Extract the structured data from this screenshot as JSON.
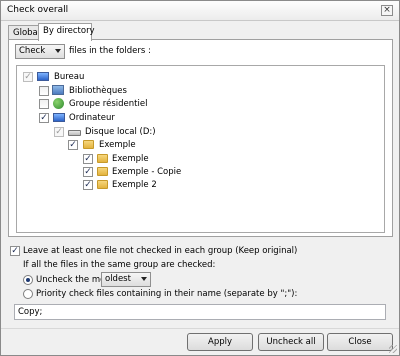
{
  "window": {
    "title": "Check overall",
    "close_glyph": "×"
  },
  "tabs": [
    {
      "label": "Global",
      "active": false
    },
    {
      "label": "By directory",
      "active": true
    }
  ],
  "by_directory": {
    "action_select": {
      "value": "Check"
    },
    "action_suffix": "files in the folders :",
    "tree": [
      {
        "label": "Bureau",
        "checked": "gray",
        "icon": "desktop-icon"
      },
      {
        "label": "Bibliothèques",
        "checked": "unchecked",
        "icon": "library-icon"
      },
      {
        "label": "Groupe résidentiel",
        "checked": "unchecked",
        "icon": "homegroup-icon"
      },
      {
        "label": "Ordinateur",
        "checked": "checked",
        "icon": "computer-icon"
      },
      {
        "label": "Disque local (D:)",
        "checked": "gray",
        "icon": "drive-icon"
      },
      {
        "label": "Exemple",
        "checked": "checked",
        "icon": "folder-icon"
      },
      {
        "label": "Exemple",
        "checked": "checked",
        "icon": "folder-icon"
      },
      {
        "label": "Exemple - Copie",
        "checked": "checked",
        "icon": "folder-icon"
      },
      {
        "label": "Exemple 2",
        "checked": "checked",
        "icon": "folder-icon"
      }
    ]
  },
  "options": {
    "keep_original_label": "Leave at least one file not checked in each group (Keep original)",
    "keep_original_checked": true,
    "same_group_label": "If all the files in the same group are checked:",
    "uncheck_most_label": "Uncheck the most",
    "uncheck_most_selected": true,
    "uncheck_most_value": "oldest",
    "priority_label": "Priority check files containing in their name (separate by \";\"):",
    "priority_selected": false,
    "priority_value": "Copy;"
  },
  "footer": {
    "apply_label": "Apply",
    "uncheck_all_label": "Uncheck all",
    "close_label": "Close"
  }
}
